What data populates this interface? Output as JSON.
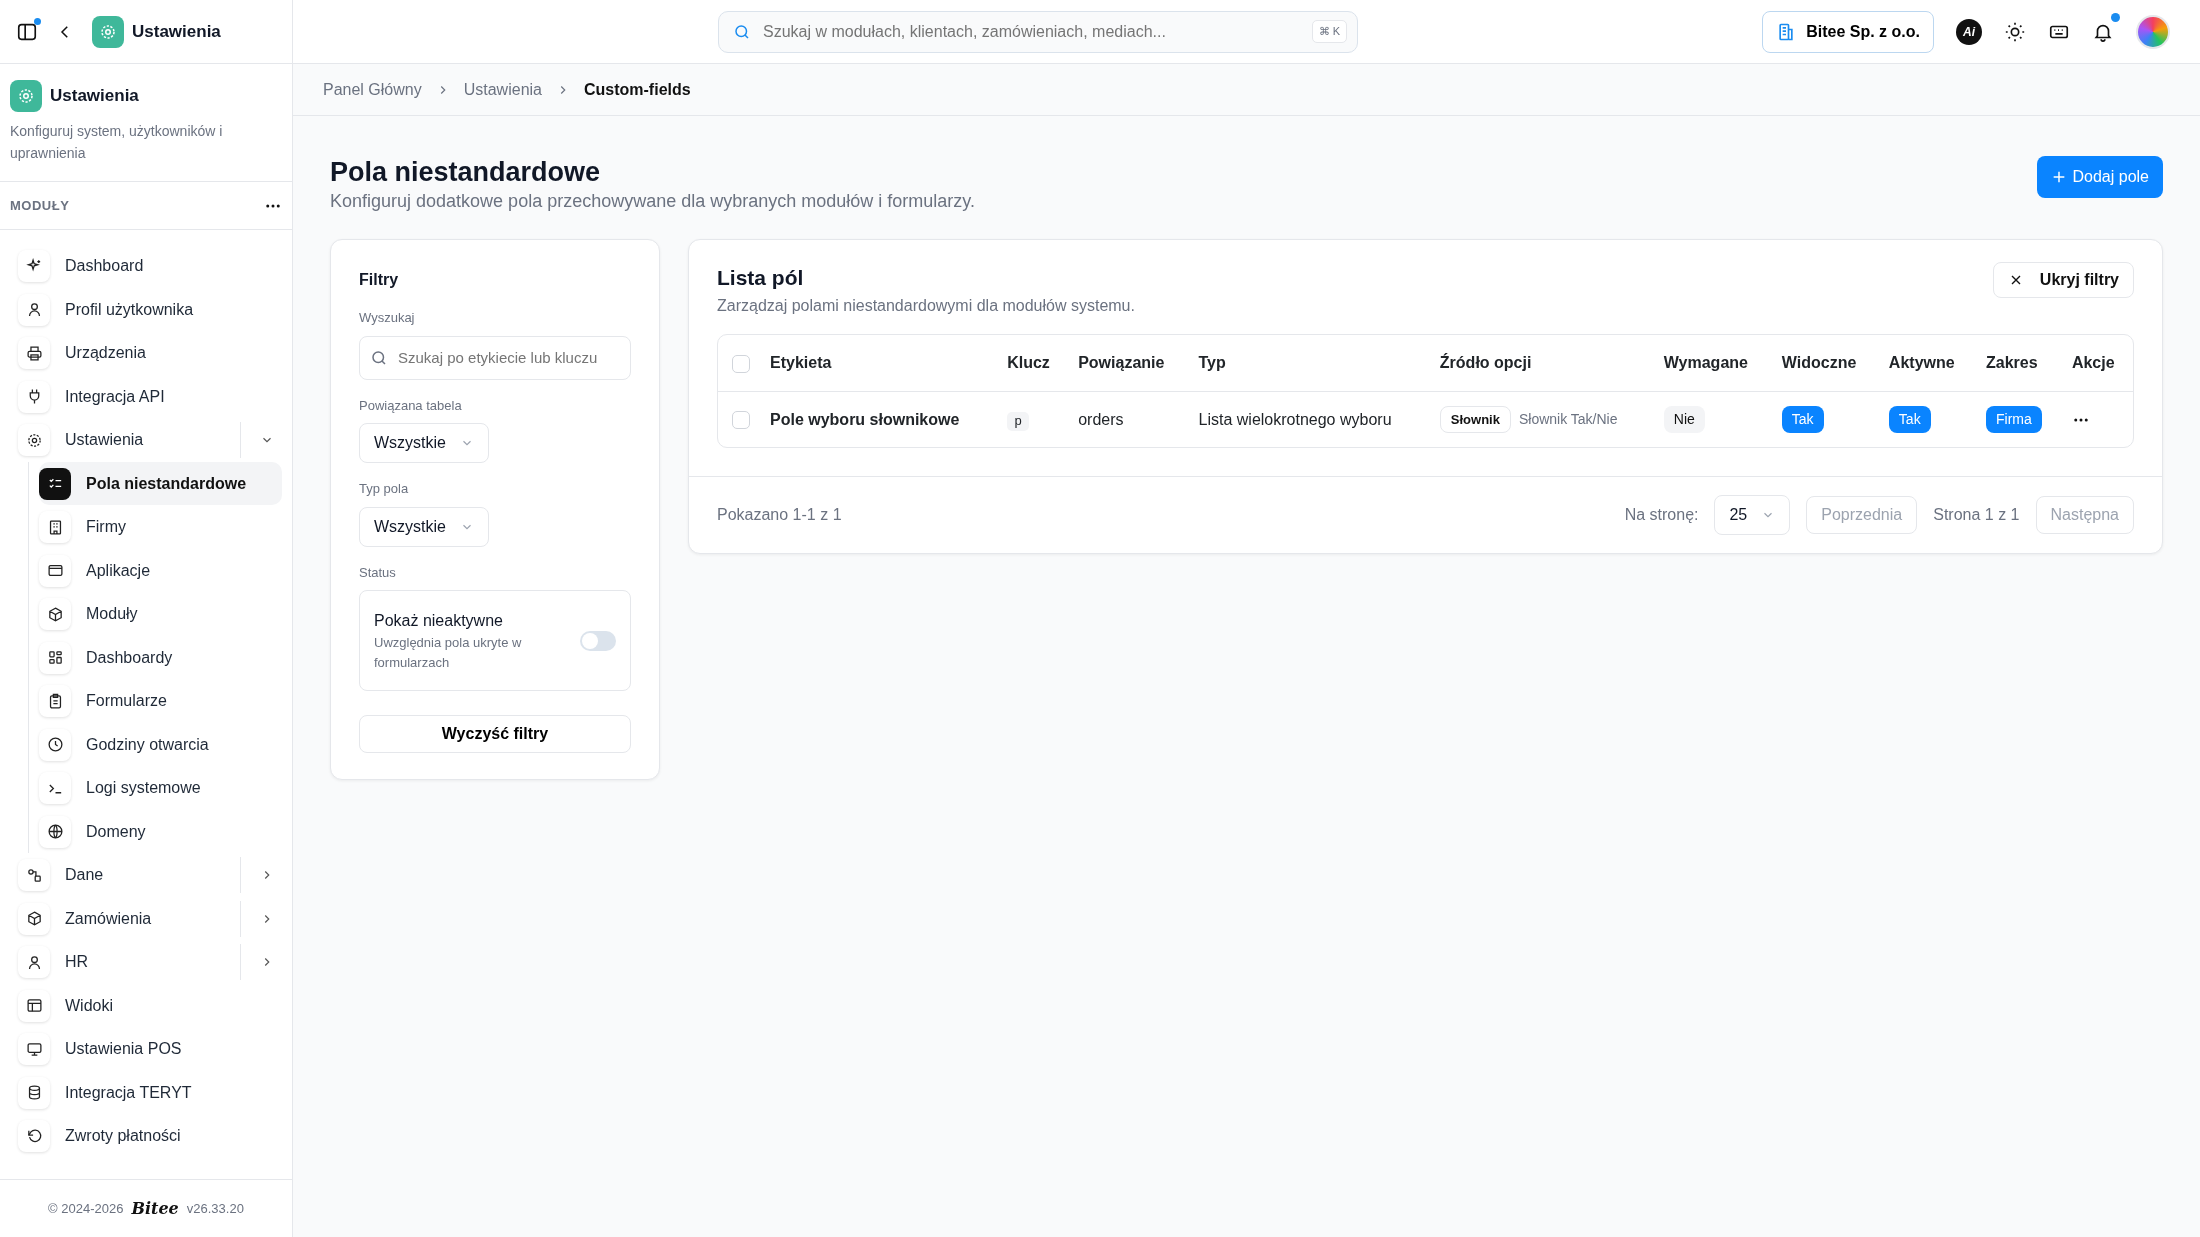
{
  "topbar": {
    "title": "Ustawienia",
    "panel_badge": true,
    "search_placeholder": "Szukaj w modułach, klientach, zamówieniach, mediach...",
    "shortcut": "⌘ K",
    "company": "Bitee Sp. z o.o.",
    "ai_label": "Ai",
    "notifications_unread": true
  },
  "sidebar": {
    "title": "Ustawienia",
    "description": "Konfiguruj system, użytkowników i uprawnienia",
    "section": "MODUŁY",
    "items": [
      {
        "kind": "link",
        "label": "Dashboard",
        "selected": false
      },
      {
        "kind": "link",
        "label": "Profil użytkownika",
        "selected": false
      },
      {
        "kind": "link",
        "label": "Urządzenia",
        "selected": false
      },
      {
        "kind": "link",
        "label": "Integracja API",
        "selected": false
      },
      {
        "kind": "group",
        "label": "Ustawienia",
        "selected": false,
        "expanded": true,
        "children": [
          {
            "label": "Pola niestandardowe",
            "selected": true
          },
          {
            "label": "Firmy",
            "selected": false
          },
          {
            "label": "Aplikacje",
            "selected": false
          },
          {
            "label": "Moduły",
            "selected": false
          },
          {
            "label": "Dashboardy",
            "selected": false
          },
          {
            "label": "Formularze",
            "selected": false
          },
          {
            "label": "Godziny otwarcia",
            "selected": false
          },
          {
            "label": "Logi systemowe",
            "selected": false
          },
          {
            "label": "Domeny",
            "selected": false
          }
        ]
      },
      {
        "kind": "group",
        "label": "Dane",
        "selected": false,
        "expanded": false
      },
      {
        "kind": "group",
        "label": "Zamówienia",
        "selected": false,
        "expanded": false
      },
      {
        "kind": "group",
        "label": "HR",
        "selected": false,
        "expanded": false
      },
      {
        "kind": "link",
        "label": "Widoki",
        "selected": false
      },
      {
        "kind": "link",
        "label": "Ustawienia POS",
        "selected": false
      },
      {
        "kind": "link",
        "label": "Integracja TERYT",
        "selected": false
      },
      {
        "kind": "link",
        "label": "Zwroty płatności",
        "selected": false
      }
    ],
    "footer": {
      "copyright": "© 2024-2026",
      "brand": "Bitee",
      "version": "v26.33.20"
    }
  },
  "breadcrumb": [
    {
      "label": "Panel Główny",
      "current": false
    },
    {
      "label": "Ustawienia",
      "current": false
    },
    {
      "label": "Custom-fields",
      "current": true
    }
  ],
  "page": {
    "title": "Pola niestandardowe",
    "subtitle": "Konfiguruj dodatkowe pola przechowywane dla wybranych modułów i formularzy.",
    "add_button": "Dodaj pole"
  },
  "filters": {
    "title": "Filtry",
    "search_label": "Wyszukaj",
    "search_placeholder": "Szukaj po etykiecie lub kluczu",
    "table_label": "Powiązana tabela",
    "table_value": "Wszystkie",
    "type_label": "Typ pola",
    "type_value": "Wszystkie",
    "status_label": "Status",
    "toggle_title": "Pokaż nieaktywne",
    "toggle_hint": "Uwzględnia pola ukryte w formularzach",
    "toggle_on": false,
    "clear_button": "Wyczyść filtry"
  },
  "list": {
    "title": "Lista pól",
    "subtitle": "Zarządzaj polami niestandardowymi dla modułów systemu.",
    "hide_filters": "Ukryj filtry",
    "select_all_checked": false,
    "columns": [
      "Etykieta",
      "Klucz",
      "Powiązanie",
      "Typ",
      "Źródło opcji",
      "Wymagane",
      "Widoczne",
      "Aktywne",
      "Zakres",
      "Akcje"
    ],
    "rows": [
      {
        "checked": false,
        "label": "Pole wyboru słownikowe",
        "key": "p",
        "relation": "orders",
        "type": "Lista wielokrotnego wyboru",
        "source_kind": "Słownik",
        "source_name": "Słownik Tak/Nie",
        "required": {
          "text": "Nie",
          "on": false
        },
        "visible": {
          "text": "Tak",
          "on": true
        },
        "active": {
          "text": "Tak",
          "on": true
        },
        "scope": "Firma"
      }
    ],
    "summary": "Pokazano 1-1 z 1",
    "per_page_label": "Na stronę:",
    "per_page": "25",
    "prev": {
      "label": "Poprzednia",
      "disabled": true
    },
    "page_info": "Strona 1 z 1",
    "next": {
      "label": "Następna",
      "disabled": true
    }
  }
}
